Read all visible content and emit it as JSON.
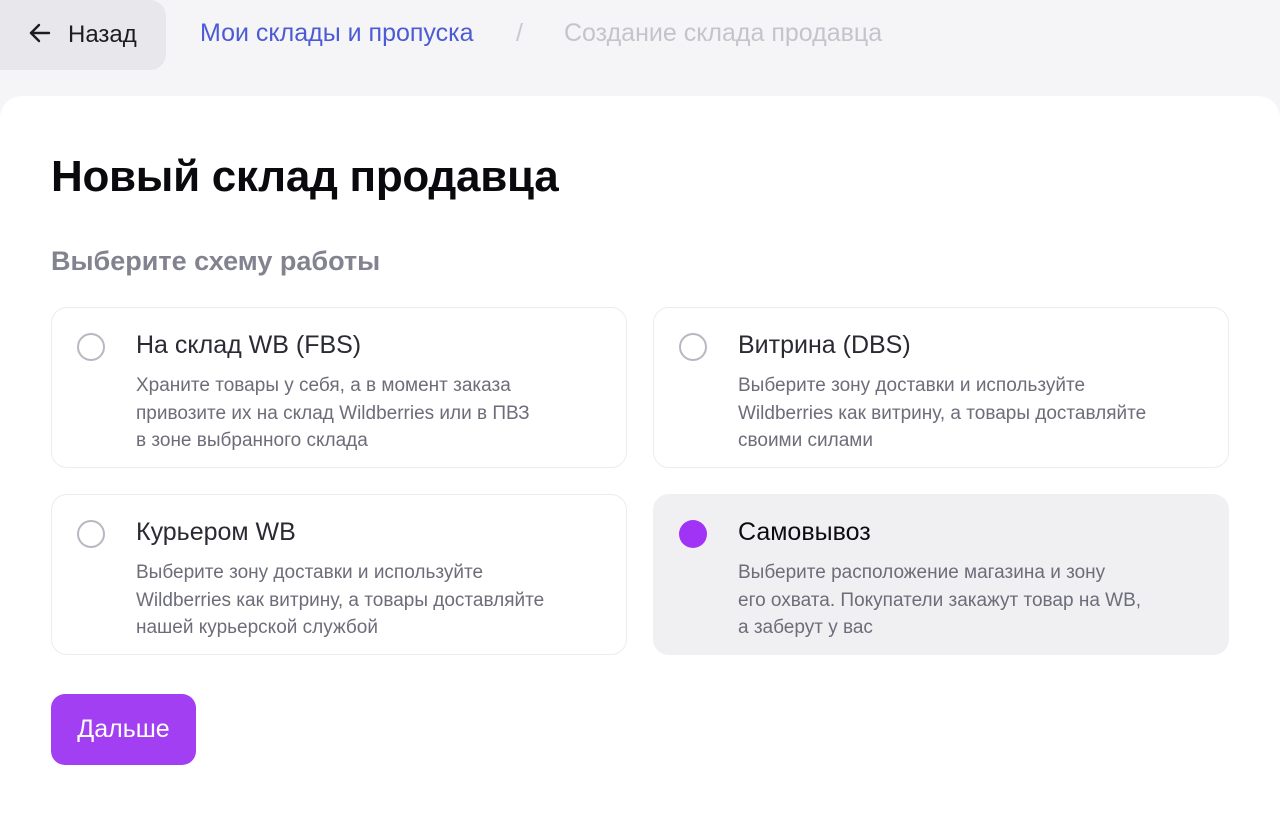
{
  "header": {
    "back_label": "Назад",
    "breadcrumb_link": "Мои склады и пропуска",
    "breadcrumb_separator": "/",
    "breadcrumb_current": "Создание склада продавца"
  },
  "main": {
    "title": "Новый склад продавца",
    "subtitle": "Выберите схему работы",
    "options": [
      {
        "title": "На склад WB (FBS)",
        "desc": [
          "Храните товары у себя, а в момент заказа",
          "привозите их на склад Wildberries или в ПВЗ",
          "в зоне выбранного склада"
        ],
        "selected": false
      },
      {
        "title": "Витрина (DBS)",
        "desc": [
          "Выберите зону доставки и используйте",
          "Wildberries как витрину, а товары доставляйте",
          "своими силами"
        ],
        "selected": false
      },
      {
        "title": "Курьером WB",
        "desc": [
          "Выберите зону доставки и используйте",
          "Wildberries как витрину, а товары доставляйте",
          "нашей курьерской службой"
        ],
        "selected": false
      },
      {
        "title": "Самовывоз",
        "desc": [
          "Выберите расположение магазина и зону",
          "его охвата. Покупатели закажут товар на WB,",
          "а заберут у вас"
        ],
        "selected": true
      }
    ],
    "next_label": "Дальше"
  },
  "colors": {
    "accent": "#a23ff2",
    "link": "#4c5bd4",
    "selected_bg": "#f0f0f3"
  },
  "icons": {
    "back": "arrow-left-icon"
  }
}
